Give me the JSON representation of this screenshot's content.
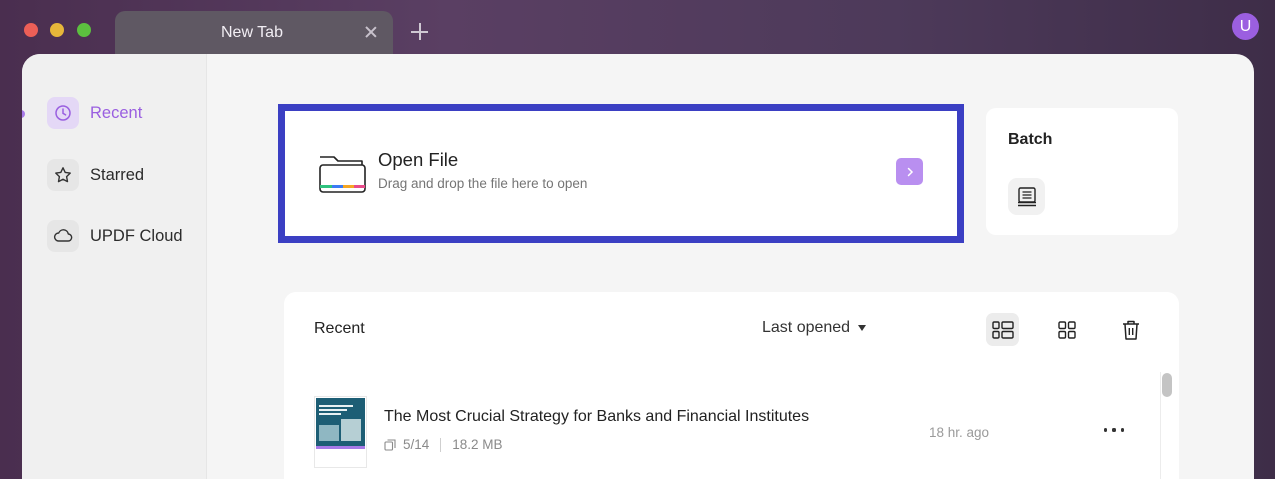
{
  "window": {
    "tab_title": "New Tab",
    "avatar_letter": "U"
  },
  "sidebar": {
    "items": [
      {
        "label": "Recent",
        "icon": "clock-icon",
        "active": true
      },
      {
        "label": "Starred",
        "icon": "star-icon",
        "active": false
      },
      {
        "label": "UPDF Cloud",
        "icon": "cloud-icon",
        "active": false
      }
    ]
  },
  "open_file": {
    "title": "Open File",
    "subtitle": "Drag and drop the file here to open",
    "icon": "folder-icon"
  },
  "batch": {
    "title": "Batch",
    "icon": "batch-stack-icon"
  },
  "recent": {
    "title": "Recent",
    "sort_label": "Last opened",
    "files": [
      {
        "name": "The Most Crucial Strategy for Banks and Financial Institutes",
        "pages": "5/14",
        "size": "18.2 MB",
        "time": "18 hr. ago"
      }
    ]
  },
  "colors": {
    "accent": "#9a5fe0",
    "highlight_border": "#3b3fc3",
    "arrow_button": "#b98ff0"
  }
}
